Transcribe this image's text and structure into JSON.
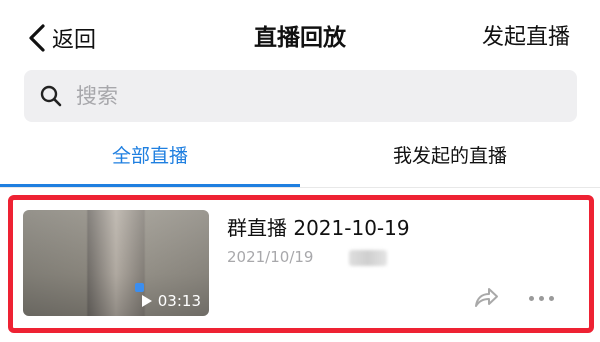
{
  "navbar": {
    "back_icon": "chevron-left-icon",
    "back_label": "返回",
    "title": "直播回放",
    "action_label": "发起直播"
  },
  "search": {
    "icon": "search-icon",
    "placeholder": "搜索"
  },
  "tabs": [
    {
      "label": "全部直播",
      "active": true
    },
    {
      "label": "我发起的直播",
      "active": false
    }
  ],
  "list": [
    {
      "title": "群直播 2021-10-19",
      "date": "2021/10/19",
      "duration": "03:13",
      "play_icon": "play-icon",
      "share_icon": "share-icon",
      "more_icon": "more-icon"
    }
  ],
  "colors": {
    "accent": "#1f7fe0",
    "highlight_border": "#ee2233",
    "search_bg": "#efeff1",
    "secondary_text": "#a8a8ab"
  }
}
